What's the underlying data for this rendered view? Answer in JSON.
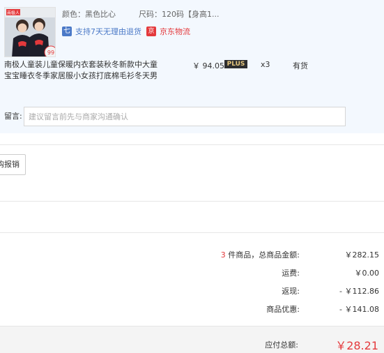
{
  "product": {
    "thumbnail_icon": "product-thumbnail",
    "thumbnail_brand": "南极人",
    "thumbnail_price_tag": "99",
    "color_label": "颜色：黑色比心",
    "size_label": "尺码：120码【身高1...",
    "service_icon": "七",
    "service_text": "支持7天无理由退货",
    "logistics_icon": "京",
    "logistics_text": "京东物流",
    "name": "南极人童装儿童保暖内衣套装秋冬新款中大童宝宝睡衣冬季家居服小女孩打底棉毛衫冬天男",
    "price": "￥ 94.05",
    "plus_badge": "PLUS",
    "quantity": "x3",
    "stock_status": "有货"
  },
  "message": {
    "label": "留言:",
    "placeholder": "建议留言前先与商家沟通确认"
  },
  "report_button": "购报销",
  "summary": {
    "item_count": "3",
    "items_label": " 件商品，总商品金额:",
    "items_value": "￥282.15",
    "shipping_label": "运费:",
    "shipping_value": "￥0.00",
    "cashback_label": "返现:",
    "cashback_value": "- ￥112.86",
    "discount_label": "商品优惠:",
    "discount_value": "- ￥141.08",
    "total_label": "应付总额:",
    "total_value": "￥28.21"
  },
  "colors": {
    "accent_red": "#e4393c",
    "service_blue": "#4b79c7",
    "panel_bg": "#f3f8fe"
  }
}
